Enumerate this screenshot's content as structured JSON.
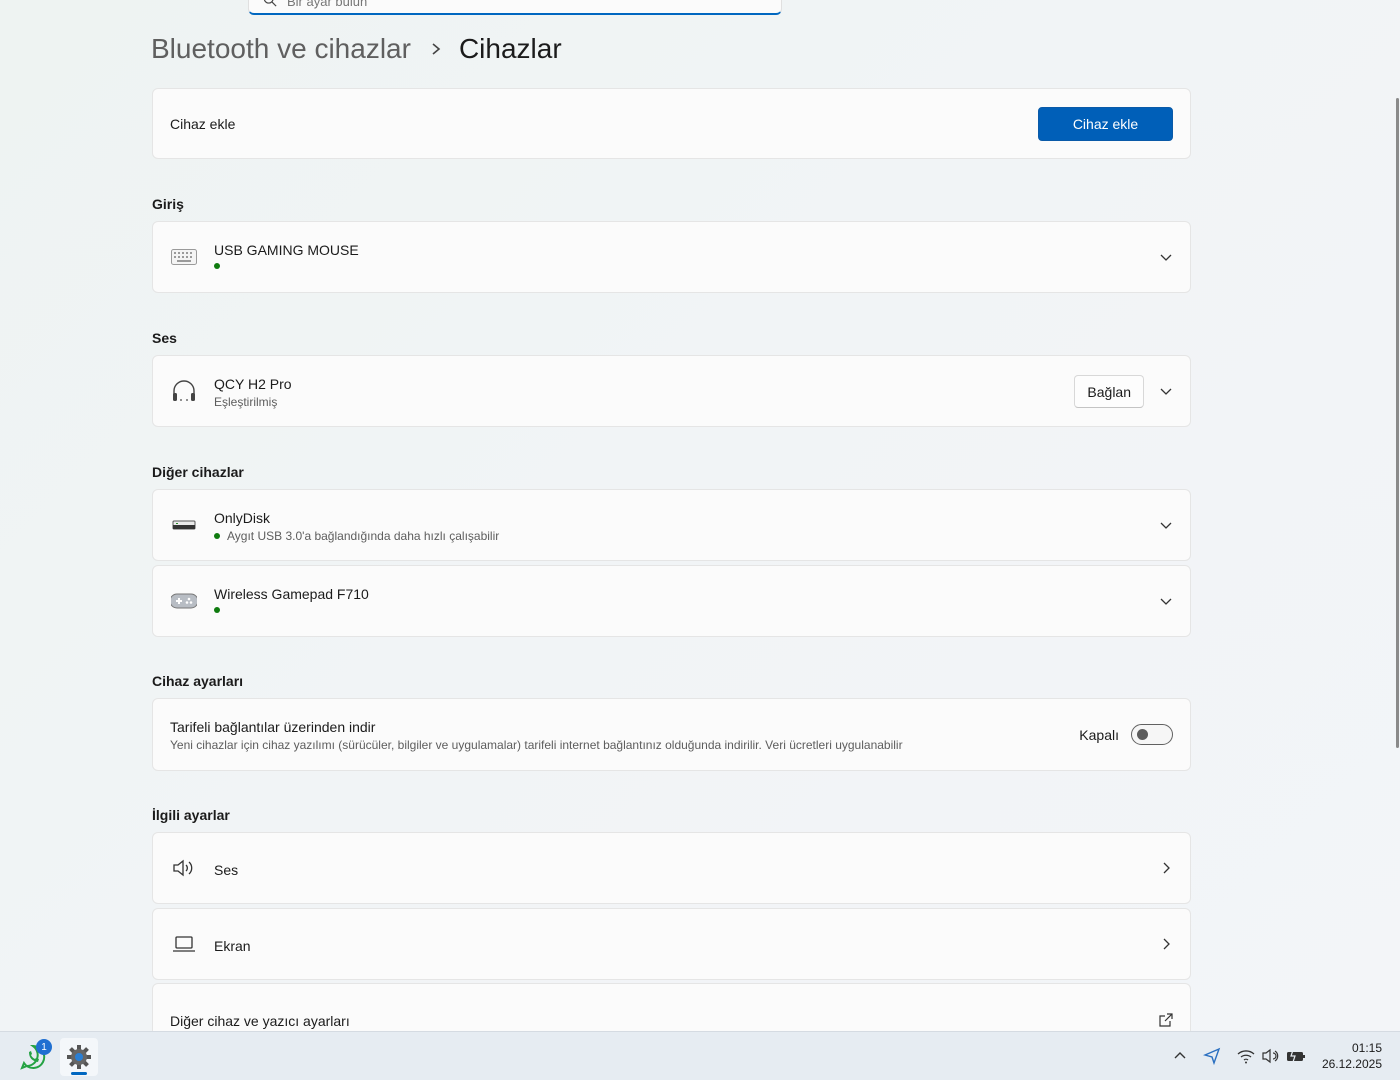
{
  "search": {
    "placeholder": "Bir ayar bulun"
  },
  "breadcrumb": {
    "parent": "Bluetooth ve cihazlar",
    "current": "Cihazlar"
  },
  "add_device": {
    "label": "Cihaz ekle",
    "button": "Cihaz ekle"
  },
  "sections": {
    "input": "Giriş",
    "audio": "Ses",
    "other": "Diğer cihazlar",
    "device_settings": "Cihaz ayarları",
    "related": "İlgili ayarlar"
  },
  "devices": {
    "mouse": {
      "name": "USB GAMING MOUSE",
      "icon": "keyboard-icon",
      "status_color": "#0f7b0f"
    },
    "headphones": {
      "name": "QCY H2 Pro",
      "status": "Eşleştirilmiş",
      "connect": "Bağlan",
      "icon": "headphones-icon"
    },
    "onlydisk": {
      "name": "OnlyDisk",
      "status": "Aygıt USB 3.0'a bağlandığında daha hızlı çalışabilir",
      "icon": "usb-drive-icon"
    },
    "gamepad": {
      "name": "Wireless Gamepad F710",
      "icon": "gamepad-icon"
    }
  },
  "metered": {
    "title": "Tarifeli bağlantılar üzerinden indir",
    "description": "Yeni cihazlar için cihaz yazılımı (sürücüler, bilgiler ve uygulamalar) tarifeli internet bağlantınız olduğunda indirilir. Veri ücretleri uygulanabilir",
    "state": "Kapalı",
    "on": false
  },
  "related": {
    "sound": "Ses",
    "display": "Ekran",
    "printers": "Diğer cihaz ve yazıcı ayarları"
  },
  "taskbar": {
    "apps": [
      {
        "name": "whatsapp-icon",
        "badge": "1"
      },
      {
        "name": "settings-icon",
        "active": true
      }
    ],
    "time": "01:15",
    "date": "26.12.2025"
  },
  "colors": {
    "accent": "#005fb8",
    "status_green": "#0f7b0f"
  }
}
